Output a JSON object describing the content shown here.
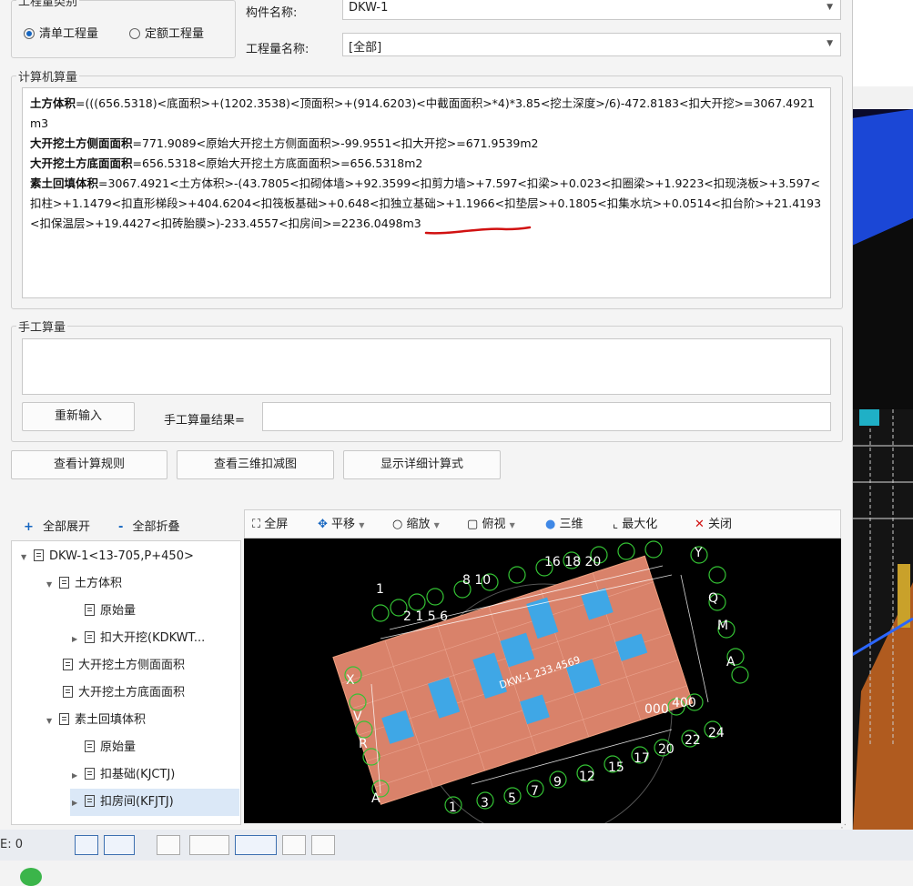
{
  "category_group": {
    "title": "工程量类别",
    "options": [
      {
        "label": "清单工程量",
        "selected": true
      },
      {
        "label": "定额工程量",
        "selected": false
      }
    ]
  },
  "fields": {
    "component_label": "构件名称:",
    "component_value": "DKW-1",
    "quantity_label": "工程量名称:",
    "quantity_value": "[全部]"
  },
  "computer_calc": {
    "title": "计算机算量",
    "lines": [
      {
        "bold": "土方体积",
        "text": "=(((656.5318)<底面积>+(1202.3538)<顶面积>+(914.6203)<中截面面积>*4)*3.85<挖土深度>/6)-472.8183<扣大开挖>=3067.4921m3"
      },
      {
        "bold": "大开挖土方侧面面积",
        "text": "=771.9089<原始大开挖土方侧面面积>-99.9551<扣大开挖>=671.9539m2"
      },
      {
        "bold": "大开挖土方底面面积",
        "text": "=656.5318<原始大开挖土方底面面积>=656.5318m2"
      },
      {
        "bold": "素土回填体积",
        "text": "=3067.4921<土方体积>-(43.7805<扣砌体墙>+92.3599<扣剪力墙>+7.597<扣梁>+0.023<扣圈梁>+1.9223<扣现浇板>+3.597<扣柱>+1.1479<扣直形梯段>+404.6204<扣筏板基础>+0.648<扣独立基础>+1.1966<扣垫层>+0.1805<扣集水坑>+0.0514<扣台阶>+21.4193<扣保温层>+19.4427<扣砖胎膜>)-233.4557<扣房间>=2236.0498m3"
      }
    ]
  },
  "manual_calc": {
    "title": "手工算量",
    "reenter_button": "重新输入",
    "result_label": "手工算量结果="
  },
  "action_buttons": {
    "rules": "查看计算规则",
    "deduct_3d": "查看三维扣减图",
    "detail": "显示详细计算式"
  },
  "tree_toolbar": {
    "expand_all": "全部展开",
    "collapse_all": "全部折叠"
  },
  "tree": [
    {
      "label": "DKW-1<13-705,P+450>",
      "level": 0,
      "toggle": "expanded"
    },
    {
      "label": "土方体积",
      "level": 1,
      "toggle": "expanded"
    },
    {
      "label": "原始量",
      "level": 2,
      "toggle": "none"
    },
    {
      "label": "扣大开挖(KDKWT...",
      "level": 2,
      "toggle": "collapsed"
    },
    {
      "label": "大开挖土方侧面面积",
      "level": 1,
      "toggle": "none"
    },
    {
      "label": "大开挖土方底面面积",
      "level": 1,
      "toggle": "none"
    },
    {
      "label": "素土回填体积",
      "level": 1,
      "toggle": "expanded"
    },
    {
      "label": "原始量",
      "level": 2,
      "toggle": "none"
    },
    {
      "label": "扣基础(KJCTJ)",
      "level": 2,
      "toggle": "collapsed"
    },
    {
      "label": "扣房间(KFJTJ)",
      "level": 2,
      "toggle": "collapsed",
      "selected": true
    }
  ],
  "viewer_toolbar": {
    "fullscreen": "全屏",
    "pan": "平移",
    "zoom": "缩放",
    "top_view": "俯视",
    "three_d": "三维",
    "maximize": "最大化",
    "close": "关闭"
  },
  "viewer": {
    "center_label": "DKW-1 233.4569"
  },
  "status": {
    "left_text": "E: 0"
  },
  "colors": {
    "accent": "#1565c0",
    "annotation": "#d11111",
    "slab": "#d9826a",
    "room": "#3fa7e6",
    "axis": "#34c334"
  }
}
